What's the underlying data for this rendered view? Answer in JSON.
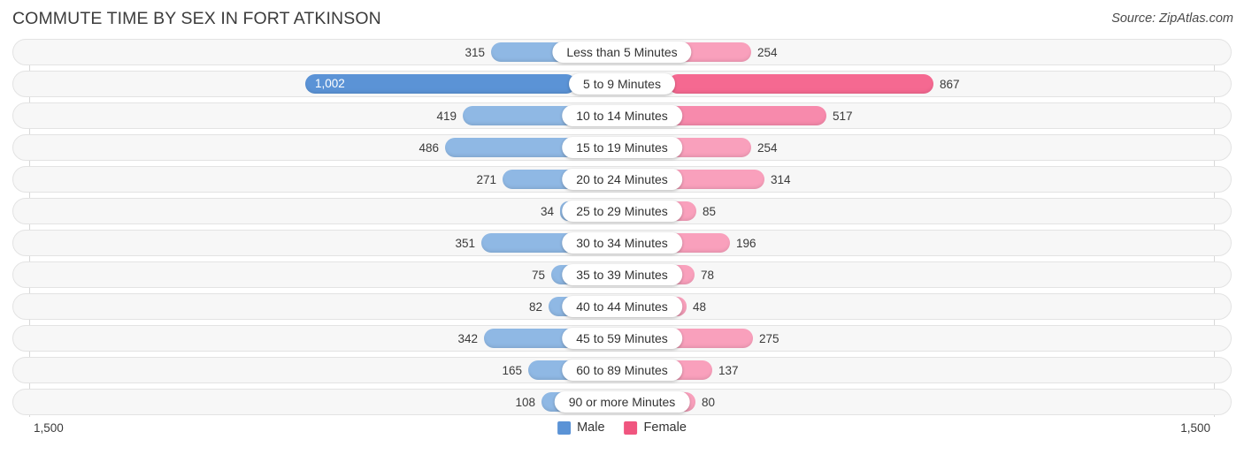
{
  "header": {
    "title": "COMMUTE TIME BY SEX IN FORT ATKINSON",
    "source": "Source: ZipAtlas.com"
  },
  "axis": {
    "min_label": "1,500",
    "max_label": "1,500",
    "scale_max": 1500
  },
  "legend": {
    "items": [
      {
        "label": "Male",
        "color": "#5b93d6"
      },
      {
        "label": "Female",
        "color": "#f0557f"
      }
    ]
  },
  "colors": {
    "male_light": "#8fb8e4",
    "male_strong": "#5b93d6",
    "female_light": "#f9a0bc",
    "female_strong": "#f56991",
    "track": "#f7f7f7",
    "track_border": "#e3e3e3"
  },
  "chart_data": {
    "type": "bar",
    "subtype": "diverging-bidirectional",
    "title": "COMMUTE TIME BY SEX IN FORT ATKINSON",
    "xlabel": "",
    "ylabel": "",
    "xlim": [
      -1500,
      1500
    ],
    "grid": false,
    "legend_position": "bottom-center",
    "categories": [
      "Less than 5 Minutes",
      "5 to 9 Minutes",
      "10 to 14 Minutes",
      "15 to 19 Minutes",
      "20 to 24 Minutes",
      "25 to 29 Minutes",
      "30 to 34 Minutes",
      "35 to 39 Minutes",
      "40 to 44 Minutes",
      "45 to 59 Minutes",
      "60 to 89 Minutes",
      "90 or more Minutes"
    ],
    "series": [
      {
        "name": "Male",
        "direction": "left",
        "values": [
          315,
          1002,
          419,
          486,
          271,
          34,
          351,
          75,
          82,
          342,
          165,
          108
        ],
        "labels": [
          "315",
          "1,002",
          "419",
          "486",
          "271",
          "34",
          "351",
          "75",
          "82",
          "342",
          "165",
          "108"
        ]
      },
      {
        "name": "Female",
        "direction": "right",
        "values": [
          254,
          867,
          517,
          254,
          314,
          85,
          196,
          78,
          48,
          275,
          137,
          80
        ],
        "labels": [
          "254",
          "867",
          "517",
          "254",
          "314",
          "85",
          "196",
          "78",
          "48",
          "275",
          "137",
          "80"
        ]
      }
    ]
  },
  "rows": [
    {
      "label": "Less than 5 Minutes",
      "male": "315",
      "female": "254",
      "male_w": 96,
      "female_w": 94,
      "male_color": "#8fb8e4",
      "female_color": "#f9a0bc",
      "male_inside": false
    },
    {
      "label": "5 to 9 Minutes",
      "male": "1,002",
      "female": "867",
      "male_w": 306,
      "female_w": 300,
      "male_color": "#5b93d6",
      "female_color": "#f56991",
      "male_inside": true
    },
    {
      "label": "10 to 14 Minutes",
      "male": "419",
      "female": "517",
      "male_w": 128,
      "female_w": 179,
      "male_color": "#8fb8e4",
      "female_color": "#f78aac",
      "male_inside": false
    },
    {
      "label": "15 to 19 Minutes",
      "male": "486",
      "female": "254",
      "male_w": 148,
      "female_w": 94,
      "male_color": "#8fb8e4",
      "female_color": "#f9a0bc",
      "male_inside": false
    },
    {
      "label": "20 to 24 Minutes",
      "male": "271",
      "female": "314",
      "male_w": 83,
      "female_w": 109,
      "male_color": "#8fb8e4",
      "female_color": "#f9a0bc",
      "male_inside": false
    },
    {
      "label": "25 to 29 Minutes",
      "male": "34",
      "female": "85",
      "male_w": 18,
      "female_w": 32,
      "male_color": "#8fb8e4",
      "female_color": "#f9a0bc",
      "male_inside": false
    },
    {
      "label": "30 to 34 Minutes",
      "male": "351",
      "female": "196",
      "male_w": 107,
      "female_w": 70,
      "male_color": "#8fb8e4",
      "female_color": "#f9a0bc",
      "male_inside": false
    },
    {
      "label": "35 to 39 Minutes",
      "male": "75",
      "female": "78",
      "male_w": 28,
      "female_w": 30,
      "male_color": "#8fb8e4",
      "female_color": "#f9a0bc",
      "male_inside": false
    },
    {
      "label": "40 to 44 Minutes",
      "male": "82",
      "female": "48",
      "male_w": 31,
      "female_w": 21,
      "male_color": "#8fb8e4",
      "female_color": "#f9a0bc",
      "male_inside": false
    },
    {
      "label": "45 to 59 Minutes",
      "male": "342",
      "female": "275",
      "male_w": 104,
      "female_w": 96,
      "male_color": "#8fb8e4",
      "female_color": "#f9a0bc",
      "male_inside": false
    },
    {
      "label": "60 to 89 Minutes",
      "male": "165",
      "female": "137",
      "male_w": 54,
      "female_w": 50,
      "male_color": "#8fb8e4",
      "female_color": "#f9a0bc",
      "male_inside": false
    },
    {
      "label": "90 or more Minutes",
      "male": "108",
      "female": "80",
      "male_w": 39,
      "female_w": 31,
      "male_color": "#8fb8e4",
      "female_color": "#f9a0bc",
      "male_inside": false
    }
  ]
}
